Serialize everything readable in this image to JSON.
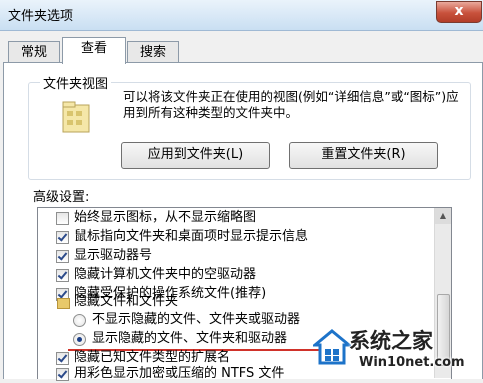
{
  "window": {
    "title": "文件夹选项",
    "close_glyph": "x"
  },
  "tabs": [
    {
      "label": "常规",
      "active": false
    },
    {
      "label": "查看",
      "active": true
    },
    {
      "label": "搜索",
      "active": false
    }
  ],
  "folder_views": {
    "group_label": "文件夹视图",
    "description": "可以将该文件夹正在使用的视图(例如“详细信息”或“图标”)应用到所有这种类型的文件夹中。",
    "apply_button": "应用到文件夹(L)",
    "reset_button": "重置文件夹(R)"
  },
  "advanced": {
    "label": "高级设置:",
    "items": [
      {
        "type": "checkbox",
        "checked": false,
        "label": "始终显示图标，从不显示缩略图"
      },
      {
        "type": "checkbox",
        "checked": true,
        "label": "鼠标指向文件夹和桌面项时显示提示信息"
      },
      {
        "type": "checkbox",
        "checked": true,
        "label": "显示驱动器号"
      },
      {
        "type": "checkbox",
        "checked": true,
        "label": "隐藏计算机文件夹中的空驱动器"
      },
      {
        "type": "checkbox",
        "checked": true,
        "label": "隐藏受保护的操作系统文件(推荐)"
      },
      {
        "type": "folder",
        "label": "隐藏文件和文件夹"
      },
      {
        "type": "radio",
        "checked": false,
        "label": "不显示隐藏的文件、文件夹或驱动器"
      },
      {
        "type": "radio",
        "checked": true,
        "label": "显示隐藏的文件、文件夹和驱动器"
      },
      {
        "type": "checkbox",
        "checked": true,
        "label": "隐藏已知文件类型的扩展名"
      },
      {
        "type": "checkbox",
        "checked": true,
        "label": "用彩色显示加密或压缩的 NTFS 文件"
      }
    ]
  },
  "watermark": {
    "title": "系统之家",
    "subtitle": "Win10net.com"
  },
  "colors": {
    "highlight_line": "#d0322a",
    "title_bar": "#c9dff2",
    "close_button": "#c8513c"
  }
}
